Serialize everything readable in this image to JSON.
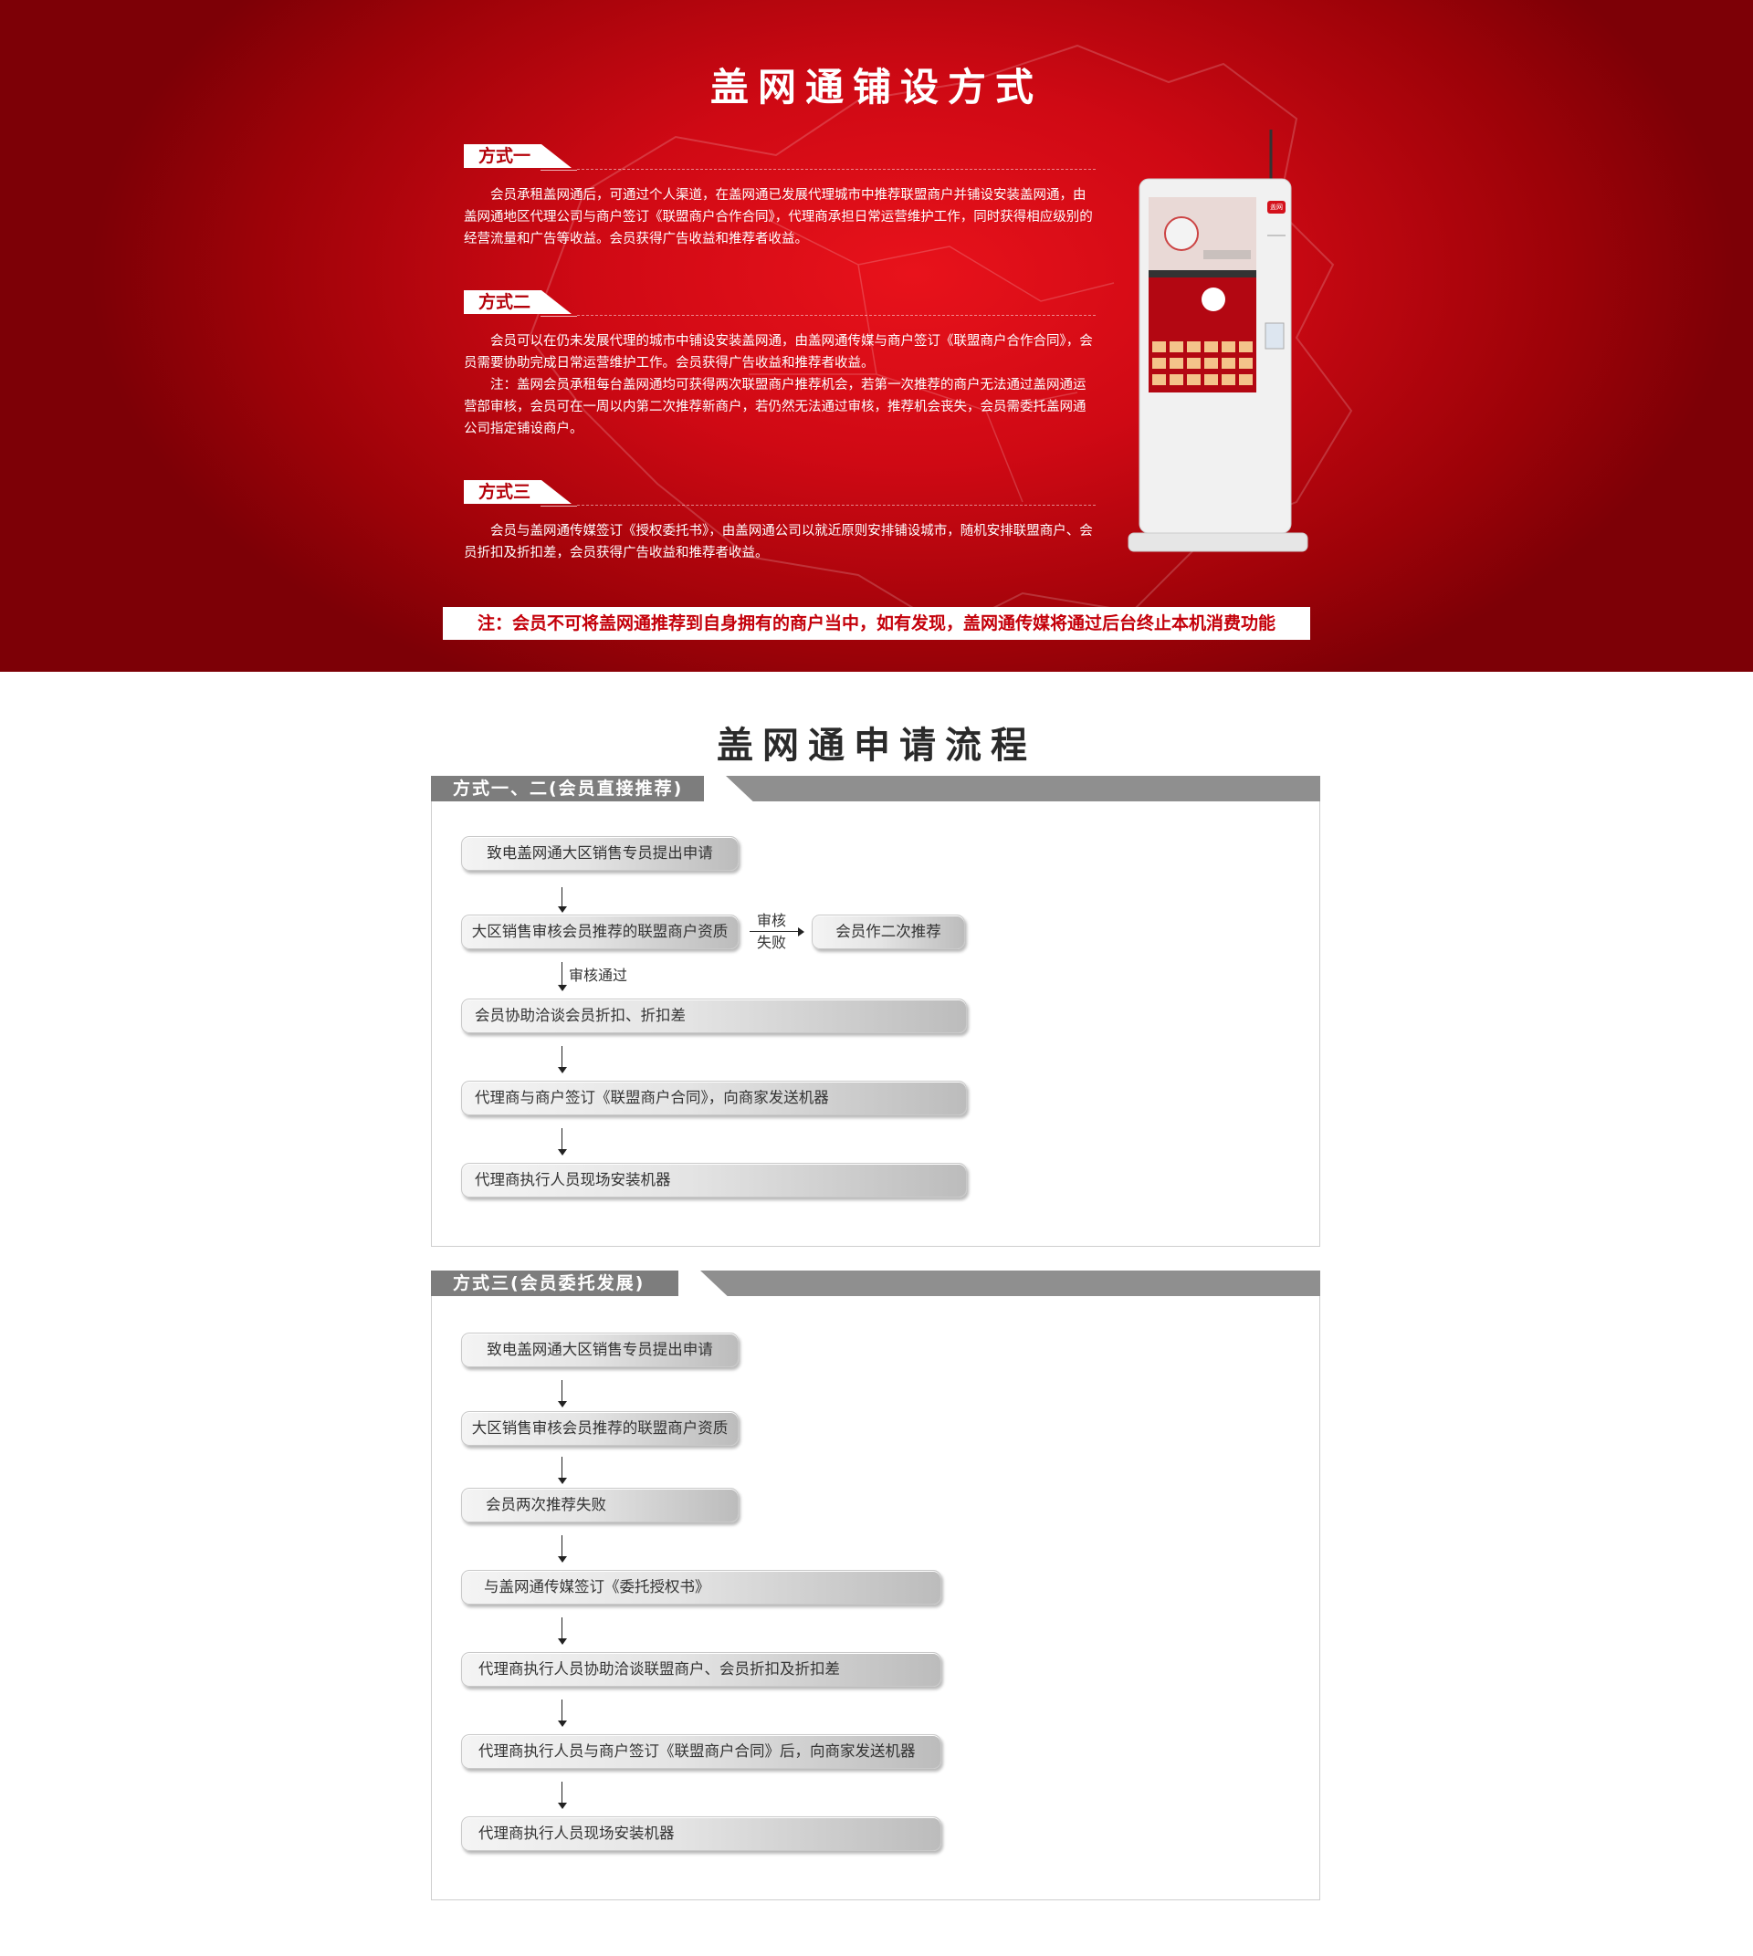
{
  "hero": {
    "title": "盖网通铺设方式",
    "methods": [
      {
        "tab": "方式一",
        "paragraphs": [
          "会员承租盖网通后，可通过个人渠道，在盖网通已发展代理城市中推荐联盟商户并铺设安装盖网通，由盖网通地区代理公司与商户签订《联盟商户合作合同》，代理商承担日常运营维护工作，同时获得相应级别的经营流量和广告等收益。会员获得广告收益和推荐者收益。"
        ]
      },
      {
        "tab": "方式二",
        "paragraphs": [
          "会员可以在仍未发展代理的城市中铺设安装盖网通，由盖网通传媒与商户签订《联盟商户合作合同》，会员需要协助完成日常运营维护工作。会员获得广告收益和推荐者收益。",
          "注：盖网会员承租每台盖网通均可获得两次联盟商户推荐机会，若第一次推荐的商户无法通过盖网通运营部审核，会员可在一周以内第二次推荐新商户，若仍然无法通过审核，推荐机会丧失，会员需委托盖网通公司指定铺设商户。"
        ]
      },
      {
        "tab": "方式三",
        "paragraphs": [
          "会员与盖网通传媒签订《授权委托书》，由盖网通公司以就近原则安排铺设城市，随机安排联盟商户、会员折扣及折扣差，会员获得广告收益和推荐者收益。"
        ]
      }
    ],
    "notice": "注：会员不可将盖网通推荐到自身拥有的商户当中，如有发现，盖网通传媒将通过后台终止本机消费功能",
    "kiosk_logo": "盖网"
  },
  "process": {
    "title": "盖网通申请流程",
    "panel1": {
      "tab": "方式一、二(会员直接推荐)",
      "steps": [
        "致电盖网通大区销售专员提出申请",
        "大区销售审核会员推荐的联盟商户资质",
        "会员协助洽谈会员折扣、折扣差",
        "代理商与商户签订《联盟商户合同》，向商家发送机器",
        "代理商执行人员现场安装机器"
      ],
      "branch_label_top": "审核",
      "branch_label_bottom": "失败",
      "branch_step": "会员作二次推荐",
      "pass_label": "审核通过"
    },
    "panel2": {
      "tab": "方式三(会员委托发展)",
      "steps": [
        "致电盖网通大区销售专员提出申请",
        "大区销售审核会员推荐的联盟商户资质",
        "会员两次推荐失败",
        "与盖网通传媒签订《委托授权书》",
        "代理商执行人员协助洽谈联盟商户、会员折扣及折扣差",
        "代理商执行人员与商户签订《联盟商户合同》后，向商家发送机器",
        "代理商执行人员现场安装机器"
      ]
    }
  }
}
